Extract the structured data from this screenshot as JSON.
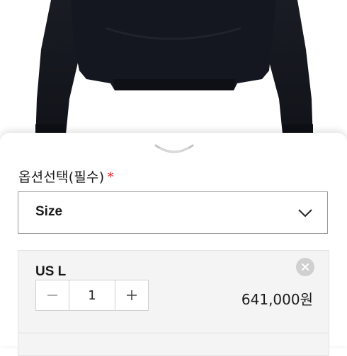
{
  "option": {
    "label": "옵션선택(필수)",
    "required_mark": "*",
    "select_value": "Size"
  },
  "selected_item": {
    "name": "US L",
    "quantity": "1",
    "price": "641,000원"
  },
  "icons": {
    "handle": "chevron-down-icon",
    "select": "chevron-down-icon",
    "remove": "close-icon",
    "decrement": "minus-icon",
    "increment": "plus-icon"
  },
  "colors": {
    "required": "#e3242b",
    "garment": "#13151c",
    "panel_bg": "#f4f4f4",
    "border": "#9a9a9a"
  }
}
